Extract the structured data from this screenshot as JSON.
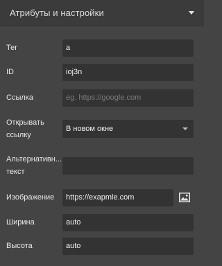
{
  "panel": {
    "title": "Атрибуты и настройки"
  },
  "fields": {
    "tag": {
      "label": "Тег",
      "value": "a"
    },
    "id": {
      "label": "ID",
      "value": "ioj3n"
    },
    "link": {
      "label": "Ссылка",
      "value": "",
      "placeholder": "eg. https://google.com"
    },
    "open": {
      "label_line1": "Открывать",
      "label_line2": "ссылку",
      "selected": "В новом окне"
    },
    "alt": {
      "label_line1": "Альтернативн...",
      "label_line2": "текст",
      "value": ""
    },
    "image": {
      "label": "Изображение",
      "value": "https://exapmle.com",
      "icon": "image-icon"
    },
    "width": {
      "label": "Ширина",
      "value": "auto"
    },
    "height": {
      "label": "Высота",
      "value": "auto"
    }
  }
}
